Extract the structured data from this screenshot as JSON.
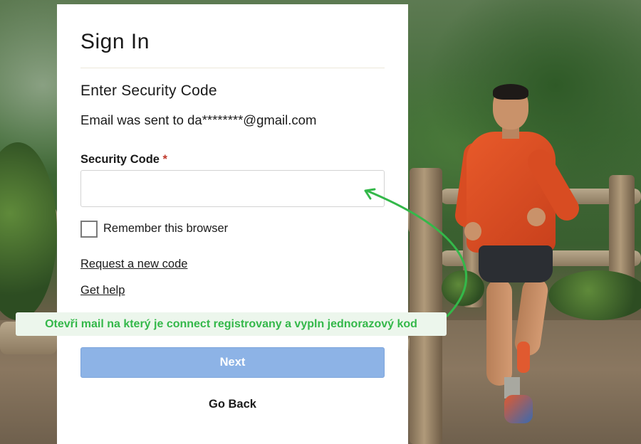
{
  "form": {
    "title": "Sign In",
    "subtitle": "Enter Security Code",
    "email_note": "Email was sent to da********@gmail.com",
    "field_label": "Security Code",
    "required_mark": "*",
    "code_value": "",
    "remember_label": "Remember this browser",
    "remember_checked": false,
    "request_code_link": "Request a new code",
    "help_link": "Get help",
    "next_button": "Next",
    "go_back_button": "Go Back"
  },
  "annotation": {
    "text": "Otevři mail na který je connect registrovany a vypln jednorazový kod",
    "color": "#34b84a"
  },
  "colors": {
    "next_button_bg": "#8db3e6",
    "required_mark": "#c0392b"
  }
}
